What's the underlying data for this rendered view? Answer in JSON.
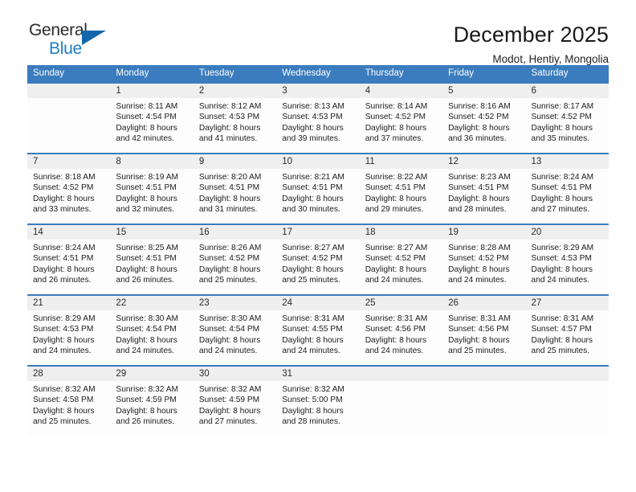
{
  "brand": {
    "name_part1": "General",
    "name_part2": "Blue",
    "logo_icon": "triangle-flag-mark"
  },
  "header": {
    "title": "December 2025",
    "subtitle": "Modot, Hentiy, Mongolia"
  },
  "colors": {
    "header_blue": "#3a7cbe",
    "brand_blue": "#1f7ec4",
    "daynum_bg": "#efefef",
    "cell_bg": "#fdfdfd"
  },
  "calendar": {
    "weekday_headers": [
      "Sunday",
      "Monday",
      "Tuesday",
      "Wednesday",
      "Thursday",
      "Friday",
      "Saturday"
    ],
    "weeks": [
      [
        {
          "day": "",
          "sunrise": "",
          "sunset": "",
          "daylight_line1": "",
          "daylight_line2": ""
        },
        {
          "day": "1",
          "sunrise": "Sunrise: 8:11 AM",
          "sunset": "Sunset: 4:54 PM",
          "daylight_line1": "Daylight: 8 hours",
          "daylight_line2": "and 42 minutes."
        },
        {
          "day": "2",
          "sunrise": "Sunrise: 8:12 AM",
          "sunset": "Sunset: 4:53 PM",
          "daylight_line1": "Daylight: 8 hours",
          "daylight_line2": "and 41 minutes."
        },
        {
          "day": "3",
          "sunrise": "Sunrise: 8:13 AM",
          "sunset": "Sunset: 4:53 PM",
          "daylight_line1": "Daylight: 8 hours",
          "daylight_line2": "and 39 minutes."
        },
        {
          "day": "4",
          "sunrise": "Sunrise: 8:14 AM",
          "sunset": "Sunset: 4:52 PM",
          "daylight_line1": "Daylight: 8 hours",
          "daylight_line2": "and 37 minutes."
        },
        {
          "day": "5",
          "sunrise": "Sunrise: 8:16 AM",
          "sunset": "Sunset: 4:52 PM",
          "daylight_line1": "Daylight: 8 hours",
          "daylight_line2": "and 36 minutes."
        },
        {
          "day": "6",
          "sunrise": "Sunrise: 8:17 AM",
          "sunset": "Sunset: 4:52 PM",
          "daylight_line1": "Daylight: 8 hours",
          "daylight_line2": "and 35 minutes."
        }
      ],
      [
        {
          "day": "7",
          "sunrise": "Sunrise: 8:18 AM",
          "sunset": "Sunset: 4:52 PM",
          "daylight_line1": "Daylight: 8 hours",
          "daylight_line2": "and 33 minutes."
        },
        {
          "day": "8",
          "sunrise": "Sunrise: 8:19 AM",
          "sunset": "Sunset: 4:51 PM",
          "daylight_line1": "Daylight: 8 hours",
          "daylight_line2": "and 32 minutes."
        },
        {
          "day": "9",
          "sunrise": "Sunrise: 8:20 AM",
          "sunset": "Sunset: 4:51 PM",
          "daylight_line1": "Daylight: 8 hours",
          "daylight_line2": "and 31 minutes."
        },
        {
          "day": "10",
          "sunrise": "Sunrise: 8:21 AM",
          "sunset": "Sunset: 4:51 PM",
          "daylight_line1": "Daylight: 8 hours",
          "daylight_line2": "and 30 minutes."
        },
        {
          "day": "11",
          "sunrise": "Sunrise: 8:22 AM",
          "sunset": "Sunset: 4:51 PM",
          "daylight_line1": "Daylight: 8 hours",
          "daylight_line2": "and 29 minutes."
        },
        {
          "day": "12",
          "sunrise": "Sunrise: 8:23 AM",
          "sunset": "Sunset: 4:51 PM",
          "daylight_line1": "Daylight: 8 hours",
          "daylight_line2": "and 28 minutes."
        },
        {
          "day": "13",
          "sunrise": "Sunrise: 8:24 AM",
          "sunset": "Sunset: 4:51 PM",
          "daylight_line1": "Daylight: 8 hours",
          "daylight_line2": "and 27 minutes."
        }
      ],
      [
        {
          "day": "14",
          "sunrise": "Sunrise: 8:24 AM",
          "sunset": "Sunset: 4:51 PM",
          "daylight_line1": "Daylight: 8 hours",
          "daylight_line2": "and 26 minutes."
        },
        {
          "day": "15",
          "sunrise": "Sunrise: 8:25 AM",
          "sunset": "Sunset: 4:51 PM",
          "daylight_line1": "Daylight: 8 hours",
          "daylight_line2": "and 26 minutes."
        },
        {
          "day": "16",
          "sunrise": "Sunrise: 8:26 AM",
          "sunset": "Sunset: 4:52 PM",
          "daylight_line1": "Daylight: 8 hours",
          "daylight_line2": "and 25 minutes."
        },
        {
          "day": "17",
          "sunrise": "Sunrise: 8:27 AM",
          "sunset": "Sunset: 4:52 PM",
          "daylight_line1": "Daylight: 8 hours",
          "daylight_line2": "and 25 minutes."
        },
        {
          "day": "18",
          "sunrise": "Sunrise: 8:27 AM",
          "sunset": "Sunset: 4:52 PM",
          "daylight_line1": "Daylight: 8 hours",
          "daylight_line2": "and 24 minutes."
        },
        {
          "day": "19",
          "sunrise": "Sunrise: 8:28 AM",
          "sunset": "Sunset: 4:52 PM",
          "daylight_line1": "Daylight: 8 hours",
          "daylight_line2": "and 24 minutes."
        },
        {
          "day": "20",
          "sunrise": "Sunrise: 8:29 AM",
          "sunset": "Sunset: 4:53 PM",
          "daylight_line1": "Daylight: 8 hours",
          "daylight_line2": "and 24 minutes."
        }
      ],
      [
        {
          "day": "21",
          "sunrise": "Sunrise: 8:29 AM",
          "sunset": "Sunset: 4:53 PM",
          "daylight_line1": "Daylight: 8 hours",
          "daylight_line2": "and 24 minutes."
        },
        {
          "day": "22",
          "sunrise": "Sunrise: 8:30 AM",
          "sunset": "Sunset: 4:54 PM",
          "daylight_line1": "Daylight: 8 hours",
          "daylight_line2": "and 24 minutes."
        },
        {
          "day": "23",
          "sunrise": "Sunrise: 8:30 AM",
          "sunset": "Sunset: 4:54 PM",
          "daylight_line1": "Daylight: 8 hours",
          "daylight_line2": "and 24 minutes."
        },
        {
          "day": "24",
          "sunrise": "Sunrise: 8:31 AM",
          "sunset": "Sunset: 4:55 PM",
          "daylight_line1": "Daylight: 8 hours",
          "daylight_line2": "and 24 minutes."
        },
        {
          "day": "25",
          "sunrise": "Sunrise: 8:31 AM",
          "sunset": "Sunset: 4:56 PM",
          "daylight_line1": "Daylight: 8 hours",
          "daylight_line2": "and 24 minutes."
        },
        {
          "day": "26",
          "sunrise": "Sunrise: 8:31 AM",
          "sunset": "Sunset: 4:56 PM",
          "daylight_line1": "Daylight: 8 hours",
          "daylight_line2": "and 25 minutes."
        },
        {
          "day": "27",
          "sunrise": "Sunrise: 8:31 AM",
          "sunset": "Sunset: 4:57 PM",
          "daylight_line1": "Daylight: 8 hours",
          "daylight_line2": "and 25 minutes."
        }
      ],
      [
        {
          "day": "28",
          "sunrise": "Sunrise: 8:32 AM",
          "sunset": "Sunset: 4:58 PM",
          "daylight_line1": "Daylight: 8 hours",
          "daylight_line2": "and 25 minutes."
        },
        {
          "day": "29",
          "sunrise": "Sunrise: 8:32 AM",
          "sunset": "Sunset: 4:59 PM",
          "daylight_line1": "Daylight: 8 hours",
          "daylight_line2": "and 26 minutes."
        },
        {
          "day": "30",
          "sunrise": "Sunrise: 8:32 AM",
          "sunset": "Sunset: 4:59 PM",
          "daylight_line1": "Daylight: 8 hours",
          "daylight_line2": "and 27 minutes."
        },
        {
          "day": "31",
          "sunrise": "Sunrise: 8:32 AM",
          "sunset": "Sunset: 5:00 PM",
          "daylight_line1": "Daylight: 8 hours",
          "daylight_line2": "and 28 minutes."
        },
        {
          "day": "",
          "sunrise": "",
          "sunset": "",
          "daylight_line1": "",
          "daylight_line2": ""
        },
        {
          "day": "",
          "sunrise": "",
          "sunset": "",
          "daylight_line1": "",
          "daylight_line2": ""
        },
        {
          "day": "",
          "sunrise": "",
          "sunset": "",
          "daylight_line1": "",
          "daylight_line2": ""
        }
      ]
    ]
  }
}
